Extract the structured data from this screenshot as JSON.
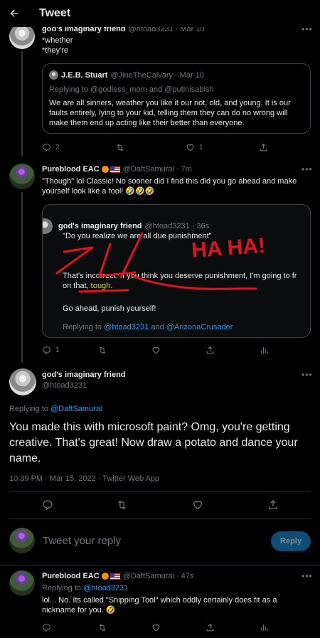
{
  "header": {
    "title": "Tweet"
  },
  "tweet1": {
    "name": "god's imaginary friend",
    "handle": "@htoad3231",
    "time": "Mar 10",
    "lines": [
      "*whether",
      "*they're"
    ],
    "quote": {
      "name": "J.E.B. Stuart",
      "handle": "@JineTheCalvary",
      "time": "Mar 10",
      "replying_prefix": "Replying to",
      "replying_to": "@godless_mom and @putinisabish",
      "text": "We are all sinners, weather you like it our not, old, and young. It is our faults entirely, lying to your kid, telling them they can do no wrong will make them end up acting like their better than everyone."
    },
    "stats": {
      "replies": "2",
      "likes": "1"
    }
  },
  "tweet2": {
    "name": "Pureblood EAC",
    "handle": "@DaftSamurai",
    "time": "7m",
    "text": "\"Though\" lol Classic! No sooner did I find this did you go ahead and make yourself look like a fool! 🤣🤣🤣",
    "media": {
      "name": "god's imaginary friend",
      "handle": "@htoad3231",
      "time": "36s",
      "line1": "\"Do you realize we are all due punishment\"",
      "line2": "That's incorrect. If you think you deserve punishment, I'm going to fr",
      "line3_a": "on that, ",
      "line3_b": "tough.",
      "line4": "Go ahead, punish yourself!",
      "reply_prefix": "Replying to",
      "reply_to": "@htoad3231 and @ArizonaCrusader",
      "scribble": "HA HA!"
    },
    "stats": {
      "replies": "1"
    }
  },
  "focus": {
    "name": "god's imaginary friend",
    "handle": "@htoad3231",
    "replying_prefix": "Replying to",
    "replying_to": "@DaftSamurai",
    "text": "You made this with microsoft paint? Omg, you're getting creative. That's great! Now draw a potato and dance your name.",
    "meta": "10:39 PM · Mar 15, 2022 · Twitter Web App"
  },
  "composer": {
    "placeholder": "Tweet your reply",
    "button": "Reply"
  },
  "tweet3": {
    "name": "Pureblood EAC",
    "handle": "@DaftSamurai",
    "time": "47s",
    "replying_prefix": "Replying to",
    "replying_to": "@htoad3231",
    "text": "lol... No. Its called \"Snipping Tool\" which oddly certainly does fit as a nickname for you. 🤣"
  },
  "colors": {
    "accent": "#1d9bf0",
    "muted": "#71767b",
    "scribble": "#e0141e"
  }
}
